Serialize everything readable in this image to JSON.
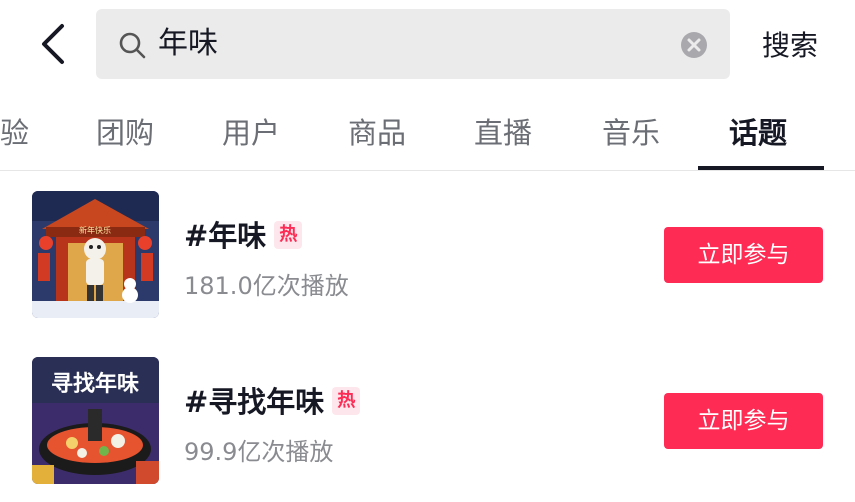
{
  "search": {
    "query": "年味",
    "submit_label": "搜索"
  },
  "tabs": [
    {
      "label": "验",
      "active": false
    },
    {
      "label": "团购",
      "active": false
    },
    {
      "label": "用户",
      "active": false
    },
    {
      "label": "商品",
      "active": false
    },
    {
      "label": "直播",
      "active": false
    },
    {
      "label": "音乐",
      "active": false
    },
    {
      "label": "话题",
      "active": true
    }
  ],
  "topics": [
    {
      "title": "#年味",
      "badge": "热",
      "plays": "181.0亿次播放",
      "action_label": "立即参与",
      "thumbnail": "lion-dance-new-year-illustration"
    },
    {
      "title": "#寻找年味",
      "badge": "热",
      "plays": "99.9亿次播放",
      "action_label": "立即参与",
      "thumbnail": "hotpot-new-year-illustration"
    }
  ],
  "thumb_texts": {
    "first": "新年快乐",
    "second": "寻找年味"
  },
  "colors": {
    "accent": "#fe2c55",
    "search_bg": "#ebebeb",
    "text_primary": "#161823",
    "text_secondary": "#8a8b91"
  }
}
